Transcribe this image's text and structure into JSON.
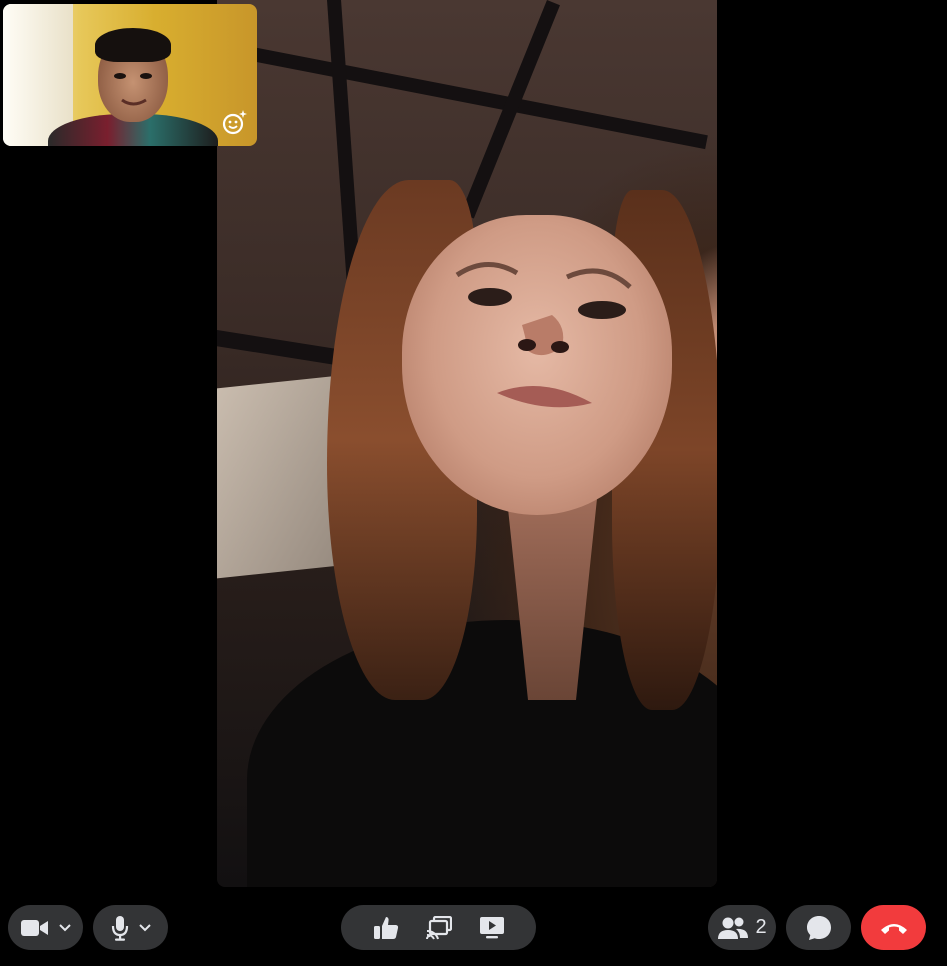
{
  "call": {
    "remote_participant_video": "remote-video-feed",
    "self_view": "self-view-thumbnail"
  },
  "controls": {
    "left": [
      {
        "name": "camera-toggle",
        "icon": "video-camera-icon",
        "has_menu": true
      },
      {
        "name": "microphone-toggle",
        "icon": "microphone-icon",
        "has_menu": true
      }
    ],
    "center": [
      {
        "name": "reaction-button",
        "icon": "thumbs-up-icon"
      },
      {
        "name": "cast-button",
        "icon": "cast-screen-icon"
      },
      {
        "name": "share-screen-button",
        "icon": "screen-share-icon"
      }
    ],
    "right": {
      "participants": {
        "icon": "people-icon",
        "count": "2"
      },
      "chat": {
        "icon": "chat-bubble-icon"
      },
      "end_call": {
        "icon": "hang-up-icon"
      }
    }
  },
  "colors": {
    "control_bg": "#333436",
    "icon": "#e4e6eb",
    "end_call": "#f23b3d",
    "background": "#000000"
  }
}
